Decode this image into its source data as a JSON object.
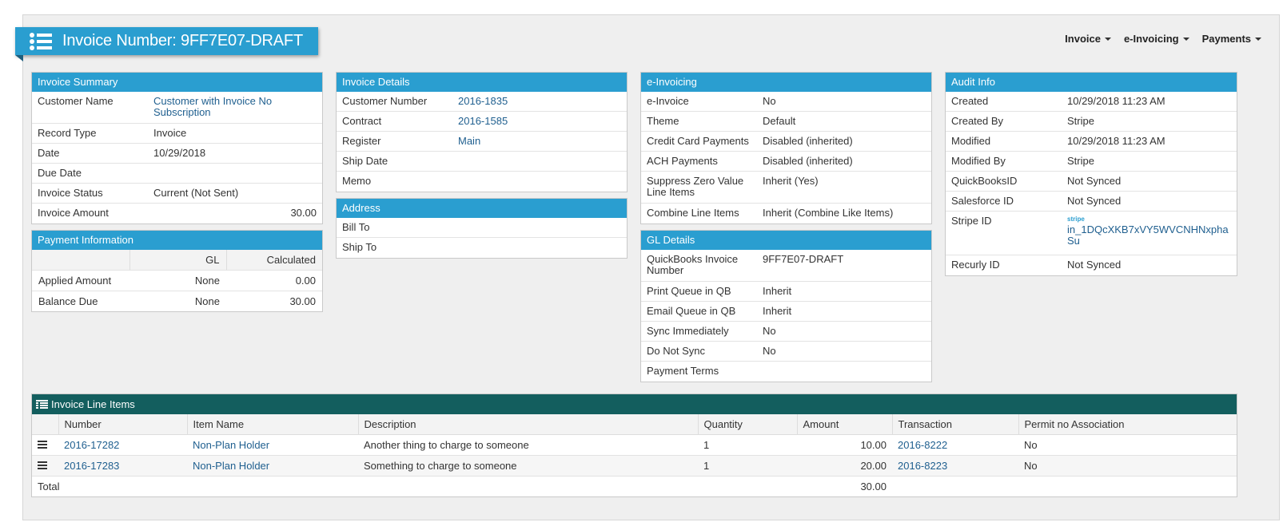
{
  "header": {
    "title": "Invoice Number: 9FF7E07-DRAFT",
    "nav": [
      {
        "label": "Invoice"
      },
      {
        "label": "e-Invoicing"
      },
      {
        "label": "Payments"
      }
    ]
  },
  "summary": {
    "title": "Invoice Summary",
    "customer_name_label": "Customer Name",
    "customer_name_value": "Customer with Invoice No Subscription",
    "record_type_label": "Record Type",
    "record_type_value": "Invoice",
    "date_label": "Date",
    "date_value": "10/29/2018",
    "due_date_label": "Due Date",
    "due_date_value": "",
    "status_label": "Invoice Status",
    "status_value": "Current (Not Sent)",
    "amount_label": "Invoice Amount",
    "amount_value": "30.00"
  },
  "payment": {
    "title": "Payment Information",
    "col_gl": "GL",
    "col_calculated": "Calculated",
    "rows": [
      {
        "label": "Applied Amount",
        "gl": "None",
        "calc": "0.00"
      },
      {
        "label": "Balance Due",
        "gl": "None",
        "calc": "30.00"
      }
    ]
  },
  "details": {
    "title": "Invoice Details",
    "customer_number_label": "Customer Number",
    "customer_number_value": "2016-1835",
    "contract_label": "Contract",
    "contract_value": "2016-1585",
    "register_label": "Register",
    "register_value": "Main",
    "ship_date_label": "Ship Date",
    "memo_label": "Memo"
  },
  "address": {
    "title": "Address",
    "bill_to_label": "Bill To",
    "ship_to_label": "Ship To"
  },
  "einvoicing": {
    "title": "e-Invoicing",
    "rows": [
      {
        "label": "e-Invoice",
        "value": "No"
      },
      {
        "label": "Theme",
        "value": "Default"
      },
      {
        "label": "Credit Card Payments",
        "value": "Disabled (inherited)"
      },
      {
        "label": "ACH Payments",
        "value": "Disabled (inherited)"
      },
      {
        "label": "Suppress Zero Value Line Items",
        "value": "Inherit (Yes)"
      },
      {
        "label": "Combine Line Items",
        "value": "Inherit (Combine Like Items)"
      }
    ]
  },
  "gl": {
    "title": "GL Details",
    "rows": [
      {
        "label": "QuickBooks Invoice Number",
        "value": "9FF7E07-DRAFT"
      },
      {
        "label": "Print Queue in QB",
        "value": "Inherit"
      },
      {
        "label": "Email Queue in QB",
        "value": "Inherit"
      },
      {
        "label": "Sync Immediately",
        "value": "No"
      },
      {
        "label": "Do Not Sync",
        "value": "No"
      },
      {
        "label": "Payment Terms",
        "value": ""
      }
    ]
  },
  "audit": {
    "title": "Audit Info",
    "created_label": "Created",
    "created_value": "10/29/2018 11:23 AM",
    "created_by_label": "Created By",
    "created_by_value": "Stripe",
    "modified_label": "Modified",
    "modified_value": "10/29/2018 11:23 AM",
    "modified_by_label": "Modified By",
    "modified_by_value": "Stripe",
    "qb_label": "QuickBooksID",
    "qb_value": "Not Synced",
    "sf_label": "Salesforce ID",
    "sf_value": "Not Synced",
    "stripe_label": "Stripe ID",
    "stripe_tag": "stripe",
    "stripe_value": "in_1DQcXKB7xVY5WVCNHNxphaSu",
    "recurly_label": "Recurly ID",
    "recurly_value": "Not Synced"
  },
  "lines": {
    "title": "Invoice Line Items",
    "columns": [
      "Number",
      "Item Name",
      "Description",
      "Quantity",
      "Amount",
      "Transaction",
      "Permit no Association"
    ],
    "rows": [
      {
        "number": "2016-17282",
        "item": "Non-Plan Holder",
        "description": "Another thing to charge to someone",
        "qty": "1",
        "amount": "10.00",
        "transaction": "2016-8222",
        "permit": "No"
      },
      {
        "number": "2016-17283",
        "item": "Non-Plan Holder",
        "description": "Something to charge to someone",
        "qty": "1",
        "amount": "20.00",
        "transaction": "2016-8223",
        "permit": "No"
      }
    ],
    "total_label": "Total",
    "total_value": "30.00"
  },
  "colors": {
    "panel_header": "#2a9ed0",
    "lines_header": "#135e5e",
    "link": "#1f5f8f"
  }
}
